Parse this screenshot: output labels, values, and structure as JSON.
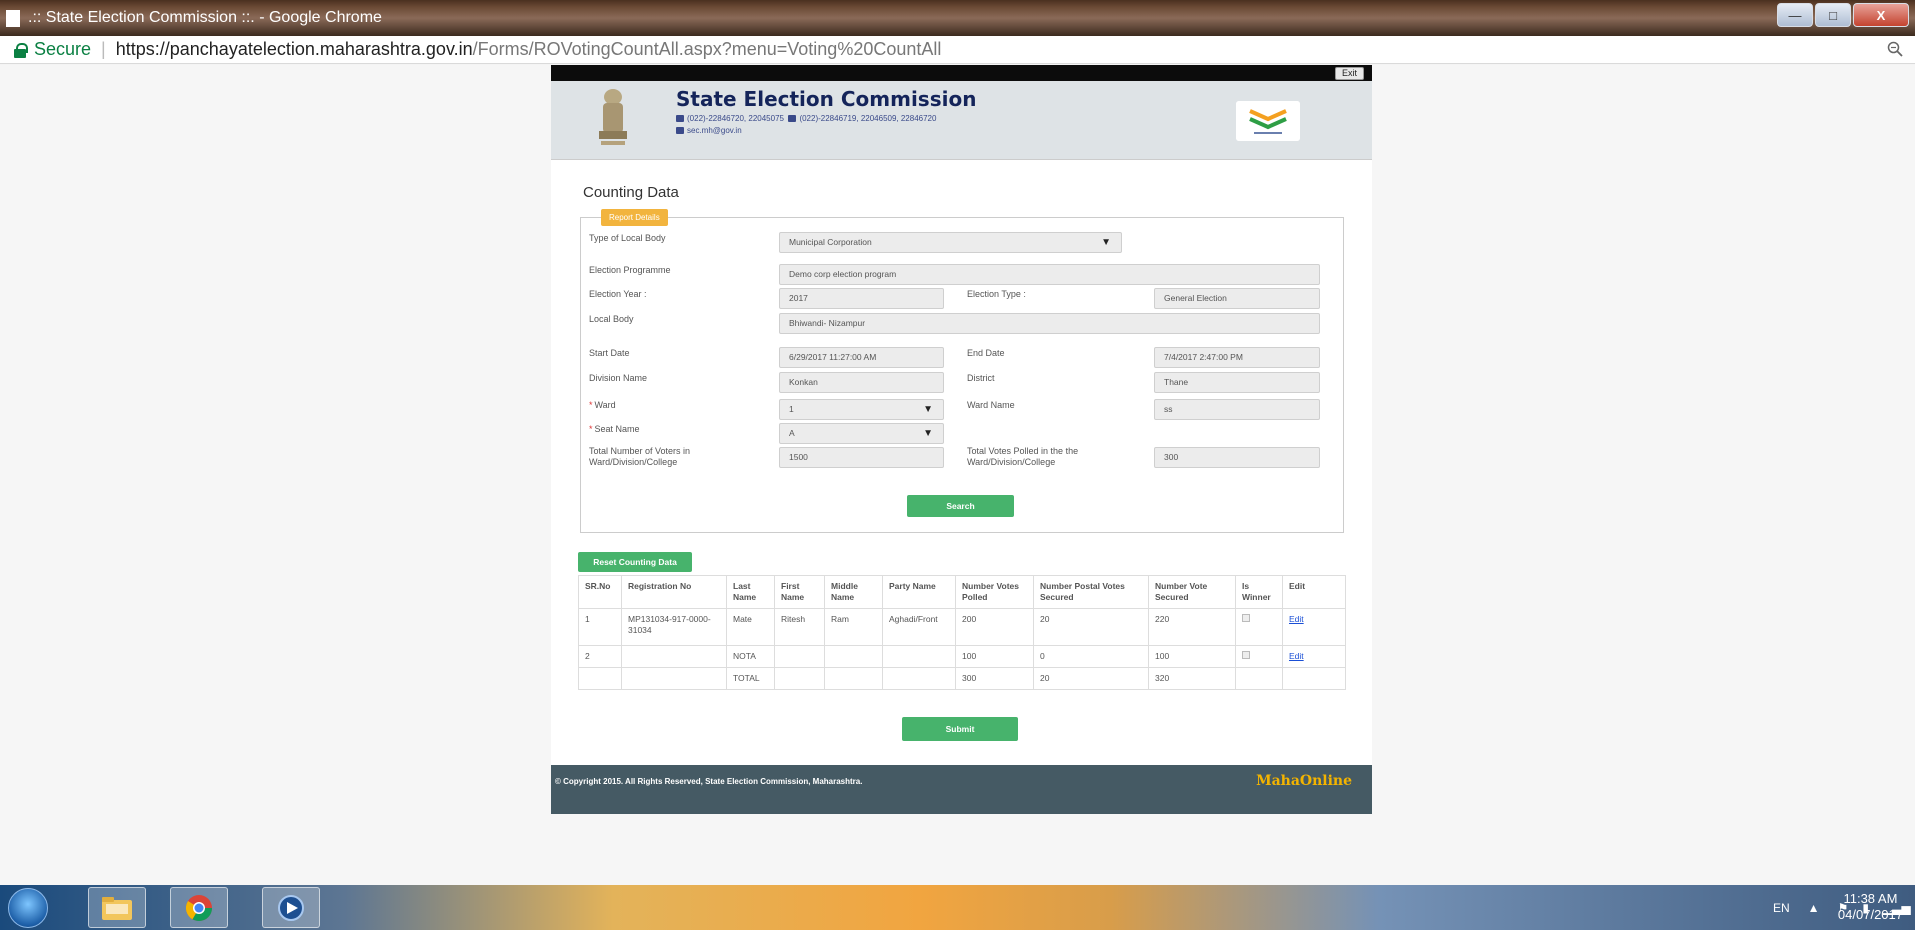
{
  "window": {
    "title": ".:: State Election Commission ::. - Google Chrome",
    "minimize": "—",
    "maximize": "□",
    "close": "X"
  },
  "address_bar": {
    "security_label": "Secure",
    "url_host": "https://panchayatelection.maharashtra.gov.in",
    "url_path": "/Forms/ROVotingCountAll.aspx?menu=Voting%20CountAll"
  },
  "header": {
    "exit_label": "Exit",
    "title": "State Election Commission",
    "phone": "(022)-22846720, 22045075",
    "fax": "(022)-22846719, 22046509, 22846720",
    "email": "sec.mh@gov.in"
  },
  "page_heading": "Counting Data",
  "report": {
    "legend": "Report Details",
    "type_of_local_body_label": "Type of Local Body",
    "type_of_local_body_value": "Municipal Corporation",
    "election_programme_label": "Election Programme",
    "election_programme_value": "Demo corp election program",
    "election_year_label": "Election Year :",
    "election_year_value": "2017",
    "election_type_label": "Election Type :",
    "election_type_value": "General Election",
    "local_body_label": "Local Body",
    "local_body_value": "Bhiwandi- Nizampur",
    "start_date_label": "Start Date",
    "start_date_value": "6/29/2017 11:27:00 AM",
    "end_date_label": "End Date",
    "end_date_value": "7/4/2017 2:47:00 PM",
    "division_label": "Division Name",
    "division_value": "Konkan",
    "district_label": "District",
    "district_value": "Thane",
    "ward_label": "Ward",
    "ward_value": "1",
    "ward_name_label": "Ward Name",
    "ward_name_value": "ss",
    "seat_name_label": "Seat Name",
    "seat_name_value": "A",
    "total_voters_label_1": "Total Number of Voters in",
    "total_voters_label_2": "Ward/Division/College",
    "total_voters_value": "1500",
    "total_polled_label_1": "Total Votes Polled in the the",
    "total_polled_label_2": "Ward/Division/College",
    "total_polled_value": "300",
    "required_mark": "*",
    "search_label": "Search"
  },
  "reset_label": "Reset Counting Data",
  "table": {
    "headers": [
      "SR.No",
      "Registration No",
      "Last Name",
      "First Name",
      "Middle Name",
      "Party Name",
      "Number Votes Polled",
      "Number Postal Votes Secured",
      "Number Vote Secured",
      "Is Winner",
      "Edit"
    ],
    "rows": [
      [
        "1",
        "MP131034-917-0000-31034",
        "Mate",
        "Ritesh",
        "Ram",
        "Aghadi/Front",
        "200",
        "20",
        "220",
        "",
        "Edit"
      ],
      [
        "2",
        "",
        "NOTA",
        "",
        "",
        "",
        "100",
        "0",
        "100",
        "",
        "Edit"
      ],
      [
        "",
        "",
        "TOTAL",
        "",
        "",
        "",
        "300",
        "20",
        "320",
        "",
        ""
      ]
    ]
  },
  "submit_label": "Submit",
  "footer": {
    "copyright": "© Copyright 2015. All Rights Reserved, State Election Commission, Maharashtra.",
    "brand": "MahaOnline"
  },
  "taskbar": {
    "language": "EN",
    "time": "11:38 AM",
    "date": "04/07/2017"
  }
}
